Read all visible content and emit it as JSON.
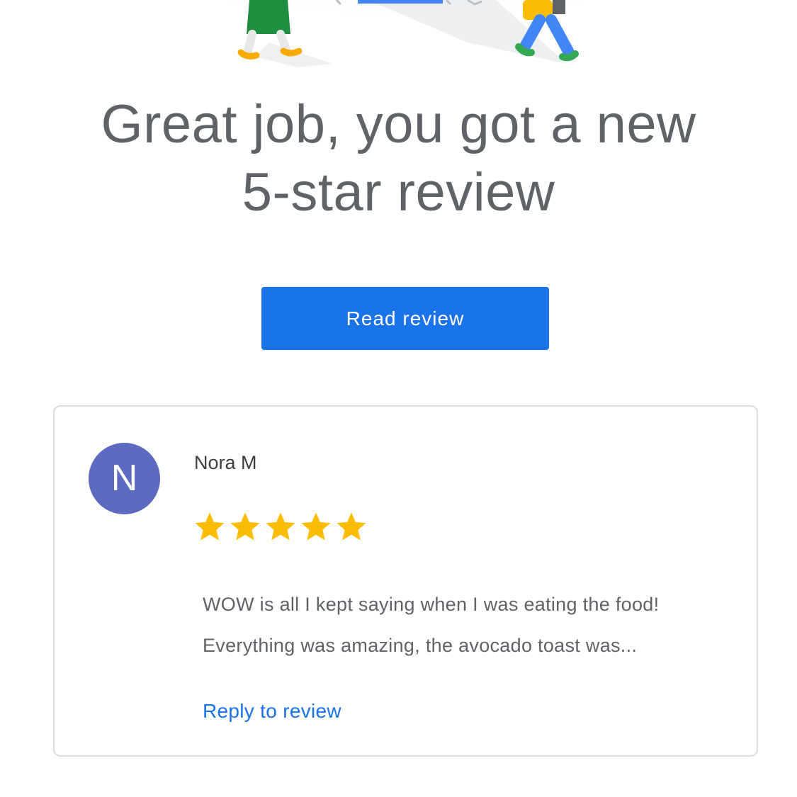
{
  "header": {
    "illustration": "people-walking-illustration"
  },
  "headline": {
    "line1": "Great job, you got a new",
    "line2": "5-star review"
  },
  "cta": {
    "label": "Read review",
    "color": "#1a73e8"
  },
  "review": {
    "avatar_initial": "N",
    "avatar_color": "#5c6bc0",
    "reviewer_name": "Nora M",
    "rating": 5,
    "star_color": "#fbbc04",
    "text_line1": "WOW is all I kept saying when I was eating the food!",
    "text_line2": "Everything was amazing, the avocado toast was...",
    "reply_label": "Reply to review"
  }
}
